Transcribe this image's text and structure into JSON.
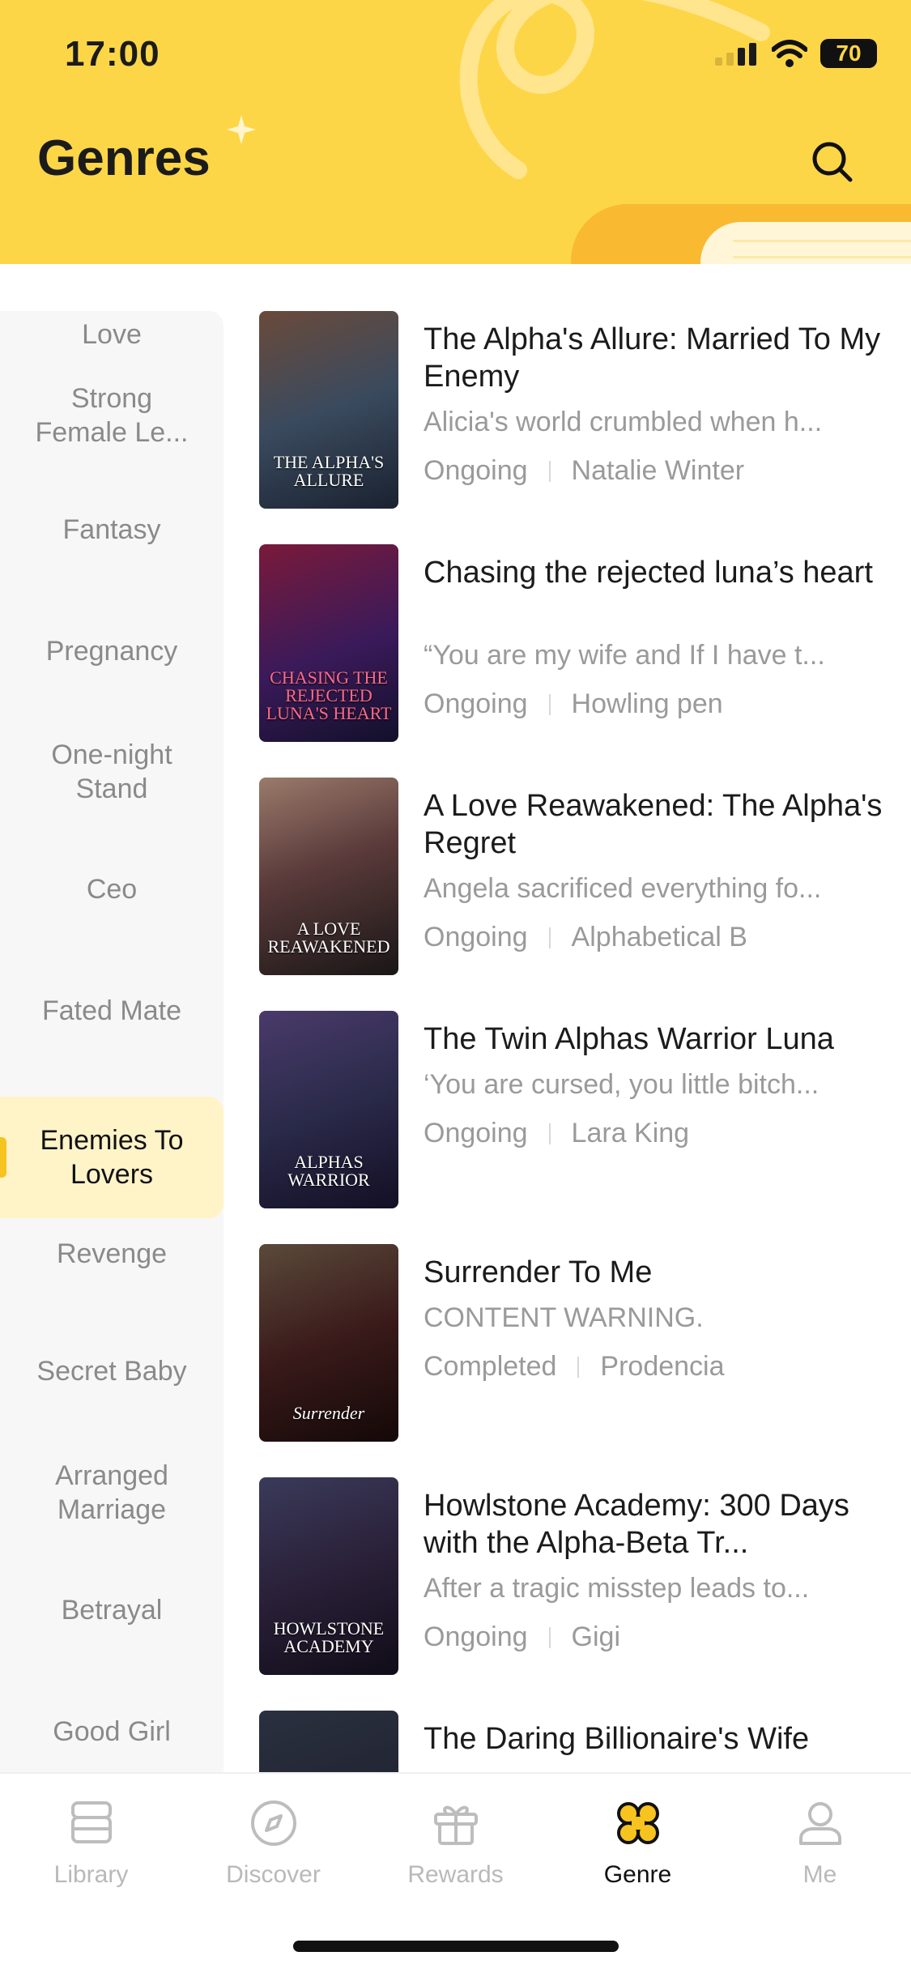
{
  "status": {
    "time": "17:00",
    "battery": "70"
  },
  "header": {
    "title": "Genres"
  },
  "colors": {
    "brand_yellow": "#fdd648",
    "accent_orange": "#f9b930",
    "active_bg": "#fff3c8"
  },
  "sidebar": {
    "genres": [
      {
        "label": "Love",
        "active": false
      },
      {
        "label": "Strong Female Le...",
        "active": false
      },
      {
        "label": "Fantasy",
        "active": false
      },
      {
        "label": "Pregnancy",
        "active": false
      },
      {
        "label": "One-night Stand",
        "active": false
      },
      {
        "label": "Ceo",
        "active": false
      },
      {
        "label": "Fated Mate",
        "active": false
      },
      {
        "label": "Enemies To Lovers",
        "active": true
      },
      {
        "label": "Revenge",
        "active": false
      },
      {
        "label": "Secret Baby",
        "active": false
      },
      {
        "label": "Arranged Marriage",
        "active": false
      },
      {
        "label": "Betrayal",
        "active": false
      },
      {
        "label": "Good Girl",
        "active": false
      }
    ]
  },
  "books": [
    {
      "title": "The Alpha's Allure: Married To My Enemy",
      "description": "Alicia's world crumbled when h...",
      "status": "Ongoing",
      "author": "Natalie Winter",
      "cover_text": "THE ALPHA'S ALLURE"
    },
    {
      "title": "Chasing the rejected luna’s heart",
      "description": "“You are my wife and If I have t...",
      "status": "Ongoing",
      "author": "Howling pen",
      "cover_text": "CHASING THE REJECTED LUNA'S HEART"
    },
    {
      "title": "A Love Reawakened: The Alpha's Regret",
      "description": "Angela sacrificed everything fo...",
      "status": "Ongoing",
      "author": "Alphabetical B",
      "cover_text": "A LOVE REAWAKENED"
    },
    {
      "title": "The Twin Alphas Warrior Luna",
      "description": "‘You are cursed, you little bitch...",
      "status": "Ongoing",
      "author": "Lara King",
      "cover_text": "ALPHAS WARRIOR"
    },
    {
      "title": "Surrender To Me",
      "description": "CONTENT WARNING.",
      "status": "Completed",
      "author": "Prodencia",
      "cover_text": "Surrender"
    },
    {
      "title": "Howlstone Academy: 300 Days with the Alpha-Beta Tr...",
      "description": "After a tragic misstep leads to...",
      "status": "Ongoing",
      "author": "Gigi",
      "cover_text": "HOWLSTONE ACADEMY"
    },
    {
      "title": "The Daring Billionaire's Wife",
      "description": "",
      "status": "",
      "author": "",
      "cover_text": ""
    }
  ],
  "tabbar": {
    "tabs": [
      {
        "label": "Library",
        "icon": "library-icon",
        "active": false
      },
      {
        "label": "Discover",
        "icon": "compass-icon",
        "active": false
      },
      {
        "label": "Rewards",
        "icon": "gift-icon",
        "active": false
      },
      {
        "label": "Genre",
        "icon": "genre-grid-icon",
        "active": true
      },
      {
        "label": "Me",
        "icon": "person-icon",
        "active": false
      }
    ]
  }
}
